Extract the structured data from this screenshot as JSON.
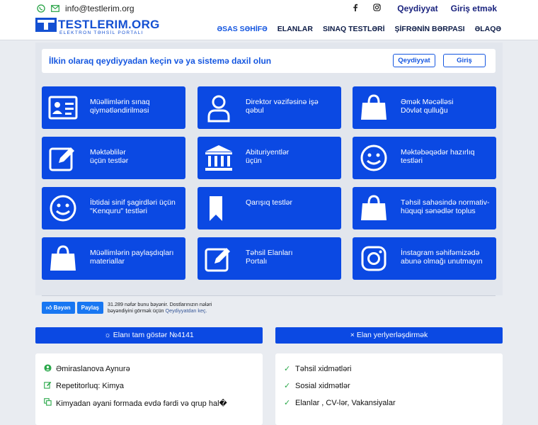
{
  "topbar": {
    "email": "info@testlerim.org",
    "register": "Qeydiyyat",
    "login": "Giriş etmək",
    "icons": [
      "whatsapp-icon",
      "mail-icon",
      "facebook-icon",
      "instagram-icon"
    ]
  },
  "header": {
    "logo_title": "TESTLERIM.ORG",
    "logo_sub": "ELEKTRON TƏHSİL PORTALI",
    "nav": [
      "ƏSAS SƏHİFƏ",
      "ELANLAR",
      "SINAQ TESTLƏRİ",
      "ŞİFRƏNİN BƏRPASI",
      "ƏLAQƏ"
    ]
  },
  "notice": {
    "text": "İlkin olaraq qeydiyyadan keçin və ya sistemə daxil olun",
    "register": "Qeydiyyat",
    "login": "Giriş"
  },
  "cards": [
    {
      "label": "Müəllimlərin sınaq\nqiymətləndirilməsi",
      "icon": "id-card-icon"
    },
    {
      "label": "Direktor vəzifəsinə işə\nqəbul",
      "icon": "user-icon"
    },
    {
      "label": "Əmək Məcəlləsi\nDövlət qulluğu",
      "icon": "shopping-bag-icon"
    },
    {
      "label": "Məktəblilər\nüçün testlər",
      "icon": "edit-icon"
    },
    {
      "label": "Abituriyentlər\nüçün",
      "icon": "institution-icon"
    },
    {
      "label": "Məktəbəqədər hazırlıq\ntestləri",
      "icon": "smile-icon"
    },
    {
      "label": "İbtidai sinif şagirdləri üçün\n\"Kenquru\" testləri",
      "icon": "smile-icon"
    },
    {
      "label": "Qarışıq testlər",
      "icon": "bookmark-icon"
    },
    {
      "label": "Təhsil sahəsində normativ-\nhüquqi sənədlər toplus",
      "icon": "shopping-bag-icon"
    },
    {
      "label": "Müəllimlərin paylaşdıqları\nmateriallar",
      "icon": "shopping-bag-icon"
    },
    {
      "label": "Təhsil Elanları\nPortalı",
      "icon": "edit-icon"
    },
    {
      "label": "İnstagram səhifəmizədə\nabunə olmağı unutmayın",
      "icon": "instagram-icon"
    }
  ],
  "facebook": {
    "like": "Bəyən",
    "share": "Paylaş",
    "text": "31.289 nəfər bunu bəyənir. Dostlarınızın nələri bəyəndiyini görmək üçün",
    "link": "Qeydiyyatdan keç."
  },
  "buttons": {
    "show_ad": "☼ Elanı tam göstər №4141",
    "post_ad": "× Elan yerlyerləşdirmək"
  },
  "left_info": [
    {
      "icon": "user-icon",
      "text": "Əmiraslanova Aynurə"
    },
    {
      "icon": "edit-icon",
      "text": "Repetitorluq: Kimya"
    },
    {
      "icon": "copy-icon",
      "text": "Kimyadan əyani formada evdə fərdi və qrup hal�"
    }
  ],
  "right_info": [
    {
      "icon": "check-icon",
      "text": "Təhsil xidmətləri"
    },
    {
      "icon": "check-icon",
      "text": "Sosial xidmətlər"
    },
    {
      "icon": "check-icon",
      "text": "Elanlar , CV-lər, Vakansiyalar"
    }
  ],
  "colors": {
    "brand": "#0b49e3",
    "accent": "#1456e0",
    "check": "#2aa84a",
    "facebook": "#1877f2"
  }
}
